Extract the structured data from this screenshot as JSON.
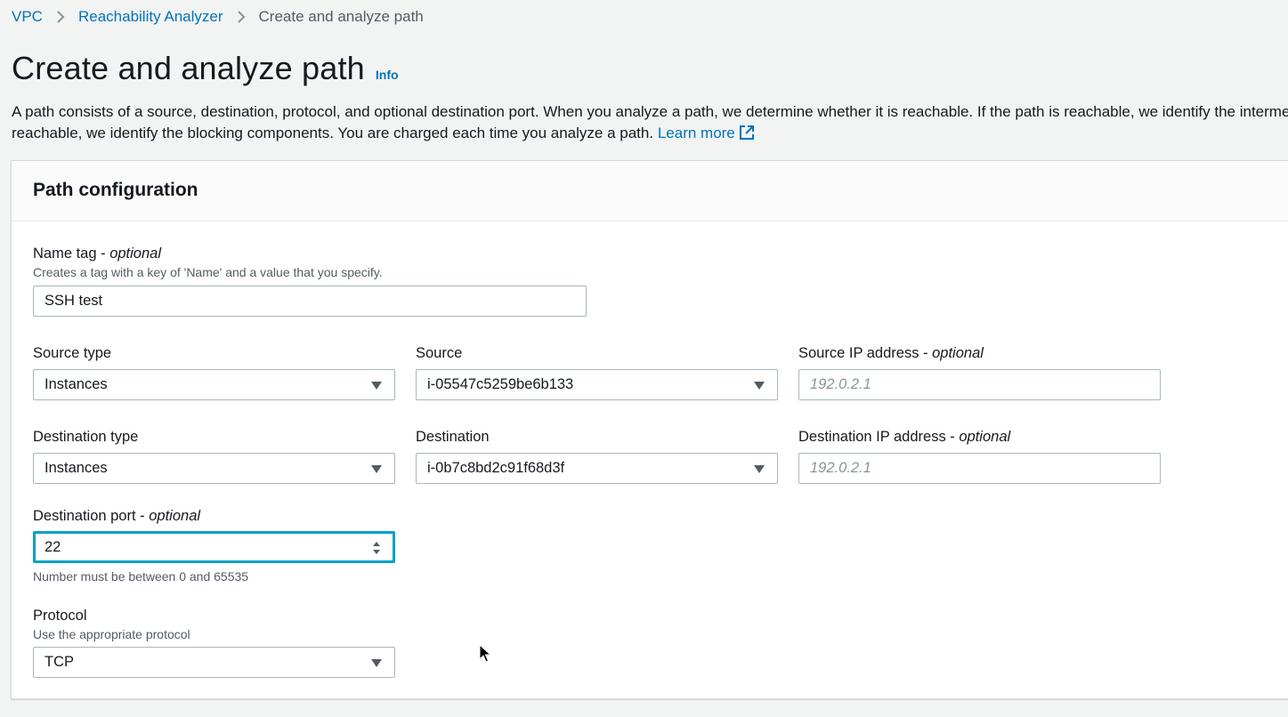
{
  "breadcrumb": {
    "items": [
      "VPC",
      "Reachability Analyzer"
    ],
    "current": "Create and analyze path"
  },
  "page": {
    "title": "Create and analyze path",
    "info_label": "Info",
    "description_line1": "A path consists of a source, destination, protocol, and optional destination port. When you analyze a path, we determine whether it is reachable. If the path is reachable, we identify the interme",
    "description_line2": "reachable, we identify the blocking components. You are charged each time you analyze a path.",
    "learn_more": "Learn more"
  },
  "panel": {
    "title": "Path configuration",
    "name_tag": {
      "label": "Name tag - ",
      "optional": "optional",
      "description": "Creates a tag with a key of 'Name' and a value that you specify.",
      "value": "SSH test"
    },
    "source_type": {
      "label": "Source type",
      "value": "Instances"
    },
    "source": {
      "label": "Source",
      "value": "i-05547c5259be6b133"
    },
    "source_ip": {
      "label": "Source IP address - ",
      "optional": "optional",
      "placeholder": "192.0.2.1"
    },
    "destination_type": {
      "label": "Destination type",
      "value": "Instances"
    },
    "destination": {
      "label": "Destination",
      "value": "i-0b7c8bd2c91f68d3f"
    },
    "destination_ip": {
      "label": "Destination IP address - ",
      "optional": "optional",
      "placeholder": "192.0.2.1"
    },
    "destination_port": {
      "label": "Destination port - ",
      "optional": "optional",
      "value": "22",
      "constraint": "Number must be between 0 and 65535"
    },
    "protocol": {
      "label": "Protocol",
      "description": "Use the appropriate protocol",
      "value": "TCP"
    }
  },
  "colors": {
    "link": "#0073bb",
    "focus": "#00a1c9",
    "background": "#f2f3f3",
    "border": "#aab7b8"
  }
}
